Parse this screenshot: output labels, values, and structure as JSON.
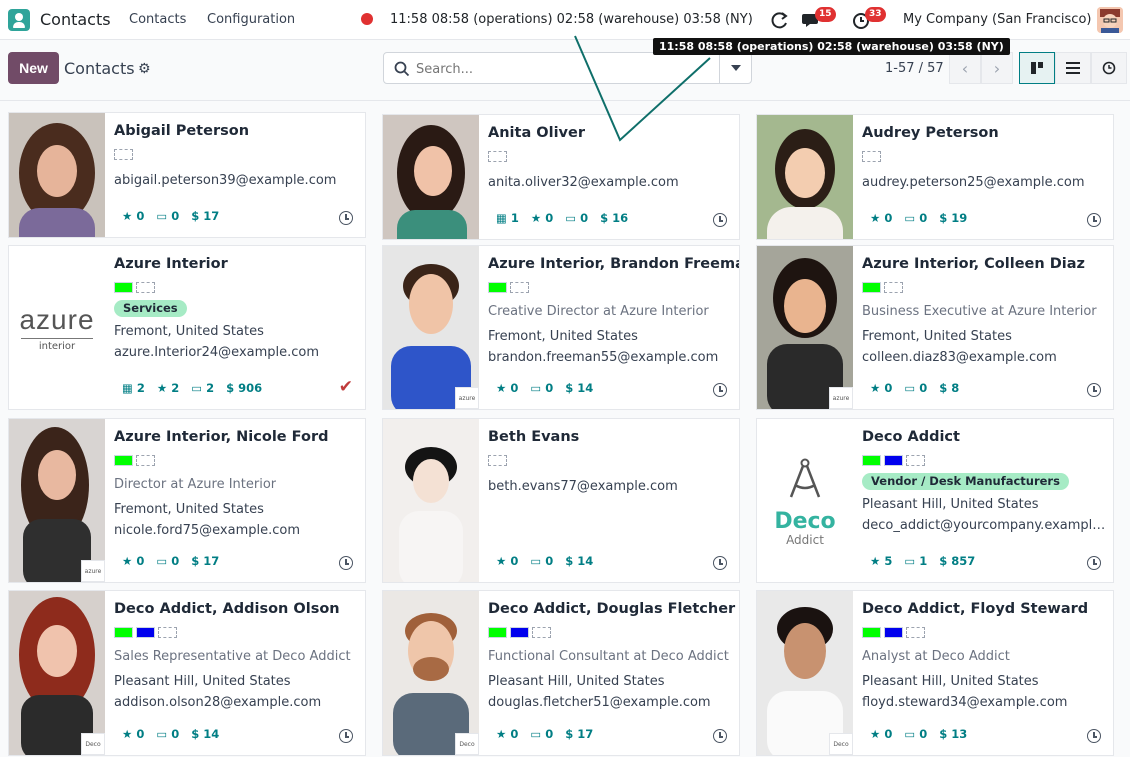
{
  "app": {
    "name": "Contacts"
  },
  "nav": {
    "items": [
      "Contacts",
      "Configuration"
    ]
  },
  "systray": {
    "clock": "11:58  08:58 (operations)  02:58 (warehouse)  03:58 (NY)",
    "messages_count": "15",
    "activities_count": "33",
    "company": "My Company (San Francisco)"
  },
  "tooltip": {
    "text": "11:58 08:58 (operations) 02:58 (warehouse) 03:58 (NY)"
  },
  "control": {
    "new_label": "New",
    "breadcrumb": "Contacts",
    "search_placeholder": "Search...",
    "pager": "1-57 / 57"
  },
  "colors": {
    "brand": "#714b67",
    "accent": "#017e84",
    "tag_green": "#00ff00",
    "tag_blue": "#0000ee"
  },
  "cards": [
    {
      "name": "Abigail Peterson",
      "email": "abigail.peterson39@example.com",
      "stars": "0",
      "invoices": "0",
      "amount": "$ 17"
    },
    {
      "name": "Anita Oliver",
      "email": "anita.oliver32@example.com",
      "meetings": "1",
      "stars": "0",
      "invoices": "0",
      "amount": "$ 16"
    },
    {
      "name": "Audrey Peterson",
      "email": "audrey.peterson25@example.com",
      "stars": "0",
      "invoices": "0",
      "amount": "$ 19"
    },
    {
      "name": "Azure Interior",
      "tag": "Services",
      "location": "Fremont, United States",
      "email": "azure.Interior24@example.com",
      "meetings": "2",
      "stars": "2",
      "invoices": "2",
      "amount": "$ 906",
      "logo_word": "azure",
      "logo_sub": "interior"
    },
    {
      "name": "Azure Interior, Brandon Freeman",
      "job": "Creative Director at Azure Interior",
      "location": "Fremont, United States",
      "email": "brandon.freeman55@example.com",
      "stars": "0",
      "invoices": "0",
      "amount": "$ 14"
    },
    {
      "name": "Azure Interior, Colleen Diaz",
      "job": "Business Executive at Azure Interior",
      "location": "Fremont, United States",
      "email": "colleen.diaz83@example.com",
      "stars": "0",
      "invoices": "0",
      "amount": "$ 8"
    },
    {
      "name": "Azure Interior, Nicole Ford",
      "job": "Director at Azure Interior",
      "location": "Fremont, United States",
      "email": "nicole.ford75@example.com",
      "stars": "0",
      "invoices": "0",
      "amount": "$ 17"
    },
    {
      "name": "Beth Evans",
      "email": "beth.evans77@example.com",
      "stars": "0",
      "invoices": "0",
      "amount": "$ 14"
    },
    {
      "name": "Deco Addict",
      "tag": "Vendor / Desk Manufacturers",
      "location": "Pleasant Hill, United States",
      "email": "deco_addict@yourcompany.exampl…",
      "stars": "5",
      "invoices": "1",
      "amount": "$ 857",
      "logo_word": "Deco",
      "logo_sub": "Addict"
    },
    {
      "name": "Deco Addict, Addison Olson",
      "job": "Sales Representative at Deco Addict",
      "location": "Pleasant Hill, United States",
      "email": "addison.olson28@example.com",
      "stars": "0",
      "invoices": "0",
      "amount": "$ 14"
    },
    {
      "name": "Deco Addict, Douglas Fletcher",
      "job": "Functional Consultant at Deco Addict",
      "location": "Pleasant Hill, United States",
      "email": "douglas.fletcher51@example.com",
      "stars": "0",
      "invoices": "0",
      "amount": "$ 17"
    },
    {
      "name": "Deco Addict, Floyd Steward",
      "job": "Analyst at Deco Addict",
      "location": "Pleasant Hill, United States",
      "email": "floyd.steward34@example.com",
      "stars": "0",
      "invoices": "0",
      "amount": "$ 13"
    }
  ],
  "mini_logos": {
    "azure": "azure",
    "deco": "Deco"
  }
}
